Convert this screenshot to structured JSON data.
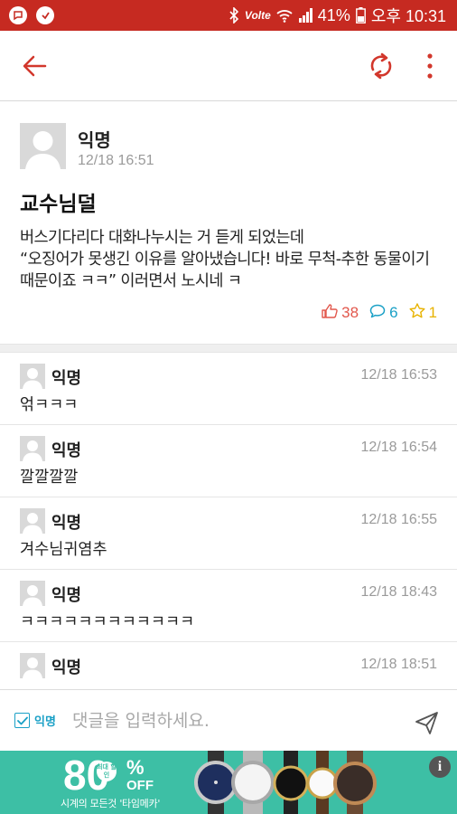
{
  "status_bar": {
    "volte": "Volte",
    "battery": "41%",
    "time": "오후 10:31",
    "notifications": [
      "message-icon",
      "app-icon"
    ]
  },
  "app_bar": {
    "icons": [
      "back-arrow-icon",
      "refresh-icon",
      "more-vert-icon"
    ],
    "accent_color": "#c62a21"
  },
  "post": {
    "author": "익명",
    "time": "12/18 16:51",
    "title": "교수님덜",
    "body": "버스기다리다 대화나누시는 거 듣게 되었는데\n“오징어가 못생긴 이유를 알아냈습니다! 바로 무척-추한 동물이기 때문이죠 ㅋㅋ” 이러면서 노시네 ㅋ",
    "likes": "38",
    "comments": "6",
    "scraps": "1"
  },
  "comments": [
    {
      "author": "익명",
      "time": "12/18 16:53",
      "text": "얶ㅋㅋㅋ"
    },
    {
      "author": "익명",
      "time": "12/18 16:54",
      "text": "깔깔깔깔"
    },
    {
      "author": "익명",
      "time": "12/18 16:55",
      "text": "겨수님귀염추"
    },
    {
      "author": "익명",
      "time": "12/18 18:43",
      "text": "ㅋㅋㅋㅋㅋㅋㅋㅋㅋㅋㅋㅋ"
    },
    {
      "author": "익명",
      "time": "12/18 18:51",
      "text": ""
    }
  ],
  "input_bar": {
    "anonymous_label": "익명",
    "anonymous_checked": true,
    "placeholder": "댓글을 입력하세요.",
    "value": ""
  },
  "ad": {
    "discount_number": "80",
    "badge_text": "최대 할인",
    "percent": "%",
    "off": "OFF",
    "caption": "시계의 모든것 '타임메카'",
    "info": "i",
    "background_color": "#3dbfa5"
  }
}
